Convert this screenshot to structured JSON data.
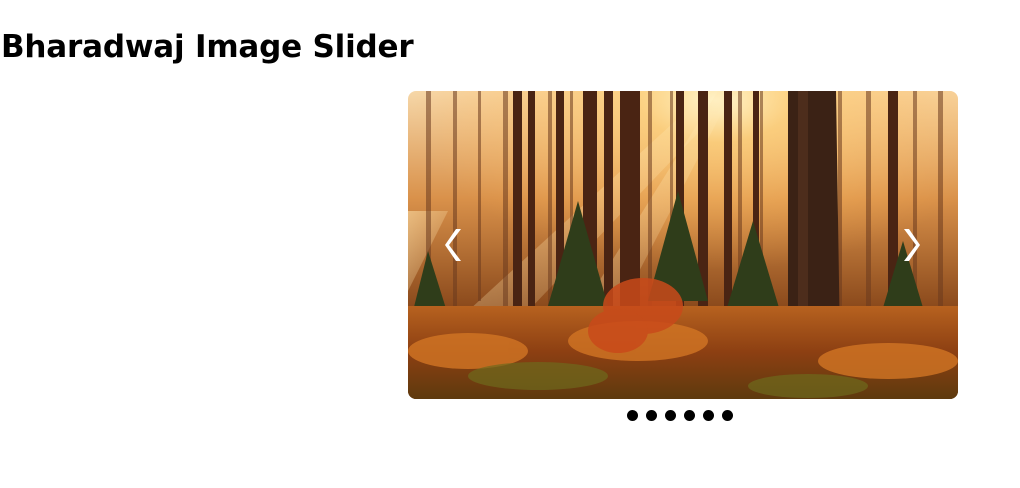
{
  "page": {
    "title": "Bharadwaj Image Slider"
  },
  "slider": {
    "current_slide": "forest-sunrise-photo",
    "slide_count": 6,
    "prev_icon": "chevron-left-icon",
    "next_icon": "chevron-right-icon",
    "arrow_color": "#ffffff",
    "dot_color": "#000000"
  }
}
